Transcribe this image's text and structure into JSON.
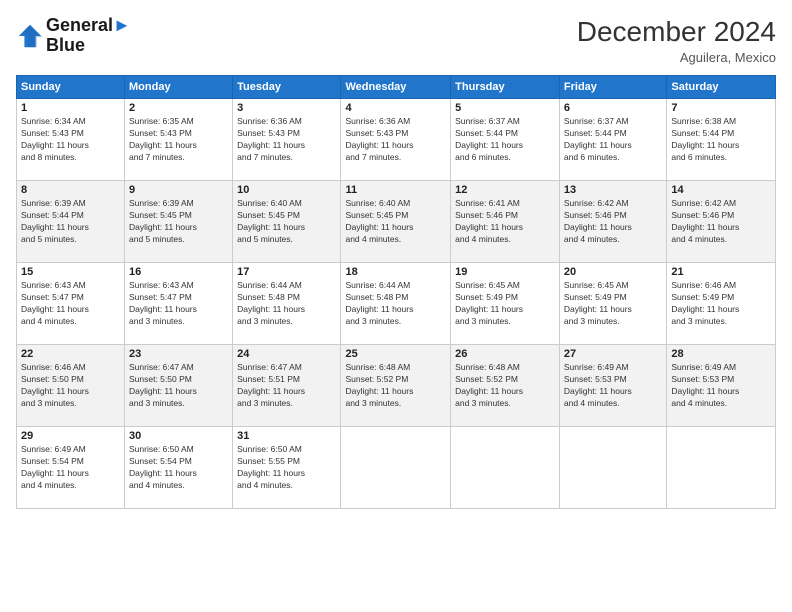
{
  "logo": {
    "line1": "General",
    "line2": "Blue"
  },
  "title": "December 2024",
  "location": "Aguilera, Mexico",
  "days_header": [
    "Sunday",
    "Monday",
    "Tuesday",
    "Wednesday",
    "Thursday",
    "Friday",
    "Saturday"
  ],
  "weeks": [
    [
      {
        "day": "1",
        "sunrise": "6:34 AM",
        "sunset": "5:43 PM",
        "daylight": "11 hours and 8 minutes."
      },
      {
        "day": "2",
        "sunrise": "6:35 AM",
        "sunset": "5:43 PM",
        "daylight": "11 hours and 7 minutes."
      },
      {
        "day": "3",
        "sunrise": "6:36 AM",
        "sunset": "5:43 PM",
        "daylight": "11 hours and 7 minutes."
      },
      {
        "day": "4",
        "sunrise": "6:36 AM",
        "sunset": "5:43 PM",
        "daylight": "11 hours and 7 minutes."
      },
      {
        "day": "5",
        "sunrise": "6:37 AM",
        "sunset": "5:44 PM",
        "daylight": "11 hours and 6 minutes."
      },
      {
        "day": "6",
        "sunrise": "6:37 AM",
        "sunset": "5:44 PM",
        "daylight": "11 hours and 6 minutes."
      },
      {
        "day": "7",
        "sunrise": "6:38 AM",
        "sunset": "5:44 PM",
        "daylight": "11 hours and 6 minutes."
      }
    ],
    [
      {
        "day": "8",
        "sunrise": "6:39 AM",
        "sunset": "5:44 PM",
        "daylight": "11 hours and 5 minutes."
      },
      {
        "day": "9",
        "sunrise": "6:39 AM",
        "sunset": "5:45 PM",
        "daylight": "11 hours and 5 minutes."
      },
      {
        "day": "10",
        "sunrise": "6:40 AM",
        "sunset": "5:45 PM",
        "daylight": "11 hours and 5 minutes."
      },
      {
        "day": "11",
        "sunrise": "6:40 AM",
        "sunset": "5:45 PM",
        "daylight": "11 hours and 4 minutes."
      },
      {
        "day": "12",
        "sunrise": "6:41 AM",
        "sunset": "5:46 PM",
        "daylight": "11 hours and 4 minutes."
      },
      {
        "day": "13",
        "sunrise": "6:42 AM",
        "sunset": "5:46 PM",
        "daylight": "11 hours and 4 minutes."
      },
      {
        "day": "14",
        "sunrise": "6:42 AM",
        "sunset": "5:46 PM",
        "daylight": "11 hours and 4 minutes."
      }
    ],
    [
      {
        "day": "15",
        "sunrise": "6:43 AM",
        "sunset": "5:47 PM",
        "daylight": "11 hours and 4 minutes."
      },
      {
        "day": "16",
        "sunrise": "6:43 AM",
        "sunset": "5:47 PM",
        "daylight": "11 hours and 3 minutes."
      },
      {
        "day": "17",
        "sunrise": "6:44 AM",
        "sunset": "5:48 PM",
        "daylight": "11 hours and 3 minutes."
      },
      {
        "day": "18",
        "sunrise": "6:44 AM",
        "sunset": "5:48 PM",
        "daylight": "11 hours and 3 minutes."
      },
      {
        "day": "19",
        "sunrise": "6:45 AM",
        "sunset": "5:49 PM",
        "daylight": "11 hours and 3 minutes."
      },
      {
        "day": "20",
        "sunrise": "6:45 AM",
        "sunset": "5:49 PM",
        "daylight": "11 hours and 3 minutes."
      },
      {
        "day": "21",
        "sunrise": "6:46 AM",
        "sunset": "5:49 PM",
        "daylight": "11 hours and 3 minutes."
      }
    ],
    [
      {
        "day": "22",
        "sunrise": "6:46 AM",
        "sunset": "5:50 PM",
        "daylight": "11 hours and 3 minutes."
      },
      {
        "day": "23",
        "sunrise": "6:47 AM",
        "sunset": "5:50 PM",
        "daylight": "11 hours and 3 minutes."
      },
      {
        "day": "24",
        "sunrise": "6:47 AM",
        "sunset": "5:51 PM",
        "daylight": "11 hours and 3 minutes."
      },
      {
        "day": "25",
        "sunrise": "6:48 AM",
        "sunset": "5:52 PM",
        "daylight": "11 hours and 3 minutes."
      },
      {
        "day": "26",
        "sunrise": "6:48 AM",
        "sunset": "5:52 PM",
        "daylight": "11 hours and 3 minutes."
      },
      {
        "day": "27",
        "sunrise": "6:49 AM",
        "sunset": "5:53 PM",
        "daylight": "11 hours and 4 minutes."
      },
      {
        "day": "28",
        "sunrise": "6:49 AM",
        "sunset": "5:53 PM",
        "daylight": "11 hours and 4 minutes."
      }
    ],
    [
      {
        "day": "29",
        "sunrise": "6:49 AM",
        "sunset": "5:54 PM",
        "daylight": "11 hours and 4 minutes."
      },
      {
        "day": "30",
        "sunrise": "6:50 AM",
        "sunset": "5:54 PM",
        "daylight": "11 hours and 4 minutes."
      },
      {
        "day": "31",
        "sunrise": "6:50 AM",
        "sunset": "5:55 PM",
        "daylight": "11 hours and 4 minutes."
      },
      null,
      null,
      null,
      null
    ]
  ]
}
